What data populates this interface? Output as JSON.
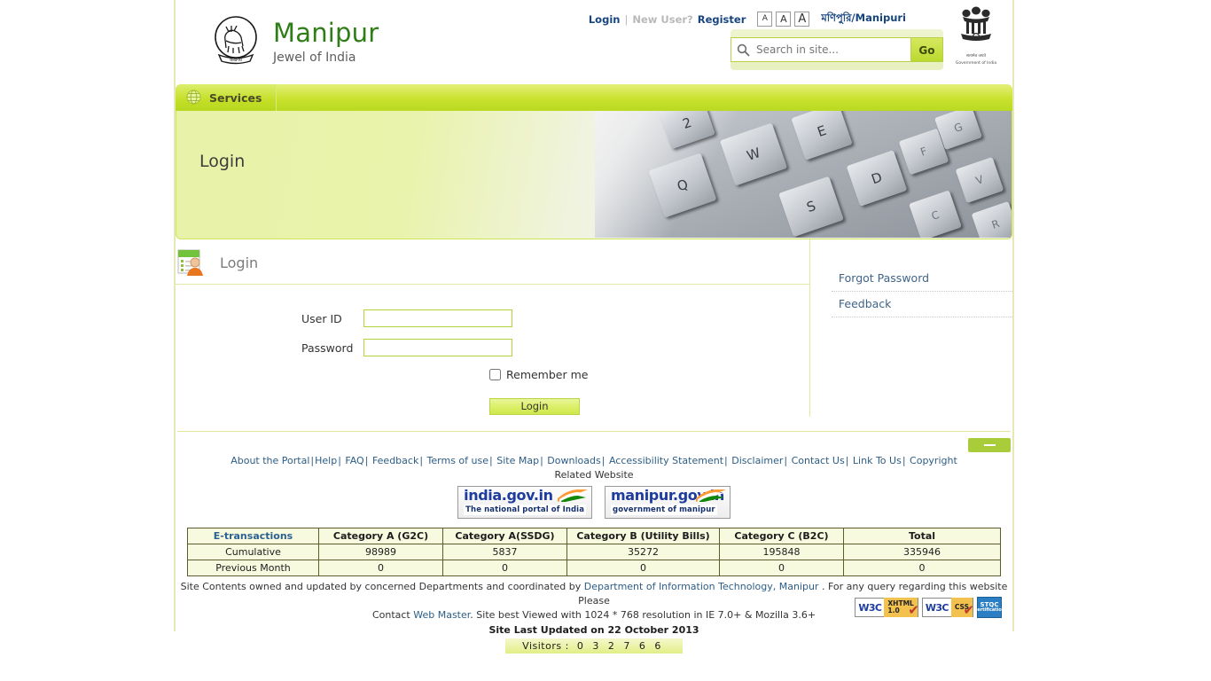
{
  "header": {
    "brand_title": "Manipur",
    "brand_subtitle": "Jewel of India",
    "emblem_caption_hi": "सत्यमेव जयते",
    "emblem_caption_en": "Government of India",
    "toplinks": {
      "login": "Login",
      "separator": "|",
      "new_user": "New User?",
      "register": "Register",
      "language": "মণিপুরি/Manipuri"
    },
    "font_sizes": [
      "A",
      "A",
      "A"
    ],
    "search": {
      "placeholder": "Search in site...",
      "value": "",
      "go_label": "Go",
      "icon": "search-icon"
    }
  },
  "nav": {
    "items": [
      {
        "label": "Services",
        "icon": "globe-icon"
      }
    ]
  },
  "banner": {
    "title": "Login",
    "image": "keyboard-photo",
    "keys": [
      "2",
      "W",
      "E",
      "Q",
      "S",
      "D",
      "F",
      "G",
      "C",
      "V",
      "R"
    ]
  },
  "login_panel": {
    "icon": "login-user-card-icon",
    "title": "Login",
    "fields": [
      {
        "label": "User ID",
        "value": "",
        "name": "user-id-field",
        "type": "text"
      },
      {
        "label": "Password",
        "value": "",
        "name": "password-field",
        "type": "password"
      }
    ],
    "remember_me_label": "Remember me",
    "remember_me_checked": false,
    "submit_label": "Login"
  },
  "sidebar": {
    "links": [
      {
        "label": "Forgot Password"
      },
      {
        "label": "Feedback"
      }
    ]
  },
  "footer": {
    "collapse_icon": "minimize-icon",
    "links": [
      "About the Portal",
      "Help",
      "FAQ",
      "Feedback",
      "Terms of use",
      "Site Map",
      "Downloads",
      "Accessibility Statement",
      "Disclaimer",
      "Contact Us",
      "Link To Us",
      "Copyright"
    ],
    "separator": "|",
    "related_website_label": "Related Website",
    "badges": [
      {
        "title": "india.gov.in",
        "subtitle": "The national portal of India"
      },
      {
        "title": "manipur.gov.in",
        "subtitle": "government of manipur"
      }
    ],
    "etransactions": {
      "headers": [
        "E-transactions",
        "Category A (G2C)",
        "Category A(SSDG)",
        "Category B (Utility Bills)",
        "Category C (B2C)",
        "Total"
      ],
      "rows": [
        [
          "Cumulative",
          "98989",
          "5837",
          "35272",
          "195848",
          "335946"
        ],
        [
          "Previous Month",
          "0",
          "0",
          "0",
          "0",
          "0"
        ]
      ]
    },
    "notice_line1_a": "Site Contents owned and updated by concerned Departments and coordinated by ",
    "notice_dit_link": "Department of Information Technology, Manipur",
    "notice_line1_b": " . For any query regarding this website Please",
    "notice_line2_a": "Contact ",
    "notice_webmaster_link": "Web Master",
    "notice_line2_b": ". Site best Viewed with 1024 * 768 resolution in IE 7.0+ & Mozilla 3.6+",
    "last_updated": "Site Last Updated on 22 October 2013",
    "visitors_label": "Visitors :",
    "visitors_digits": [
      "0",
      "3",
      "2",
      "7",
      "6",
      "6"
    ],
    "compliance": [
      {
        "left": "W3C",
        "line1": "XHTML",
        "line2": "1.0"
      },
      {
        "left": "W3C",
        "line1": "CSS",
        "line2": ""
      }
    ],
    "stqc": {
      "line1": "STQC",
      "line2": "Certification"
    }
  },
  "colors": {
    "brand_green": "#2f7d16",
    "nav_green": "#c4df27",
    "link_blue": "#2c5d86",
    "field_border": "#b2d33a",
    "banner_bg": "#e8f2a8"
  }
}
